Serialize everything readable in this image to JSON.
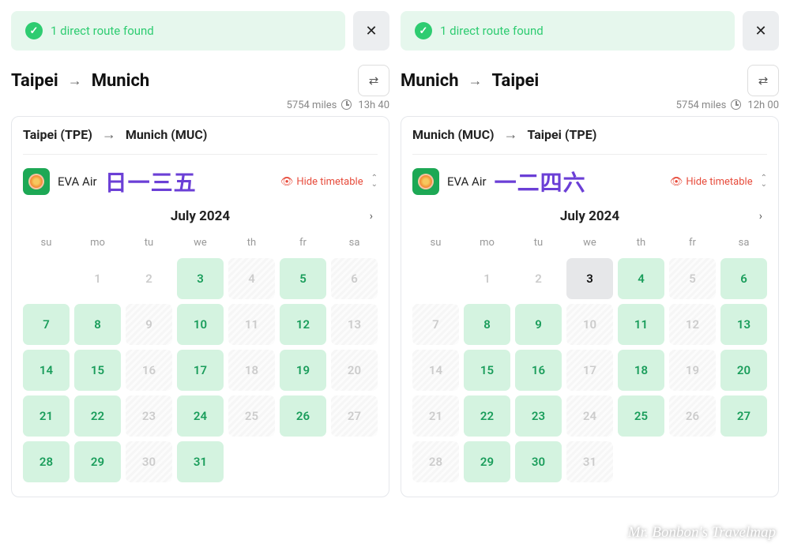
{
  "panels": [
    {
      "alert": "1 direct route found",
      "route": {
        "origin": "Taipei",
        "dest": "Munich"
      },
      "miles": "5754 miles",
      "duration": "13h 40",
      "airports": {
        "origin": "Taipei (TPE)",
        "dest": "Munich (MUC)"
      },
      "airline": "EVA Air",
      "annotation": "日一三五",
      "hide_label": "Hide timetable",
      "month": "July 2024",
      "weekdays": [
        "su",
        "mo",
        "tu",
        "we",
        "th",
        "fr",
        "sa"
      ],
      "days": [
        {
          "n": "",
          "s": "empty"
        },
        {
          "n": "1",
          "s": "disabled"
        },
        {
          "n": "2",
          "s": "disabled"
        },
        {
          "n": "3",
          "s": "available"
        },
        {
          "n": "4",
          "s": "unavailable"
        },
        {
          "n": "5",
          "s": "available"
        },
        {
          "n": "6",
          "s": "unavailable"
        },
        {
          "n": "7",
          "s": "available"
        },
        {
          "n": "8",
          "s": "available"
        },
        {
          "n": "9",
          "s": "unavailable"
        },
        {
          "n": "10",
          "s": "available"
        },
        {
          "n": "11",
          "s": "unavailable"
        },
        {
          "n": "12",
          "s": "available"
        },
        {
          "n": "13",
          "s": "unavailable"
        },
        {
          "n": "14",
          "s": "available"
        },
        {
          "n": "15",
          "s": "available"
        },
        {
          "n": "16",
          "s": "unavailable"
        },
        {
          "n": "17",
          "s": "available"
        },
        {
          "n": "18",
          "s": "unavailable"
        },
        {
          "n": "19",
          "s": "available"
        },
        {
          "n": "20",
          "s": "unavailable"
        },
        {
          "n": "21",
          "s": "available"
        },
        {
          "n": "22",
          "s": "available"
        },
        {
          "n": "23",
          "s": "unavailable"
        },
        {
          "n": "24",
          "s": "available"
        },
        {
          "n": "25",
          "s": "unavailable"
        },
        {
          "n": "26",
          "s": "available"
        },
        {
          "n": "27",
          "s": "unavailable"
        },
        {
          "n": "28",
          "s": "available"
        },
        {
          "n": "29",
          "s": "available"
        },
        {
          "n": "30",
          "s": "unavailable"
        },
        {
          "n": "31",
          "s": "available"
        }
      ]
    },
    {
      "alert": "1 direct route found",
      "route": {
        "origin": "Munich",
        "dest": "Taipei"
      },
      "miles": "5754 miles",
      "duration": "12h 00",
      "airports": {
        "origin": "Munich (MUC)",
        "dest": "Taipei (TPE)"
      },
      "airline": "EVA Air",
      "annotation": "一二四六",
      "hide_label": "Hide timetable",
      "month": "July 2024",
      "weekdays": [
        "su",
        "mo",
        "tu",
        "we",
        "th",
        "fr",
        "sa"
      ],
      "days": [
        {
          "n": "",
          "s": "empty"
        },
        {
          "n": "1",
          "s": "disabled"
        },
        {
          "n": "2",
          "s": "disabled"
        },
        {
          "n": "3",
          "s": "selected"
        },
        {
          "n": "4",
          "s": "available"
        },
        {
          "n": "5",
          "s": "unavailable"
        },
        {
          "n": "6",
          "s": "available"
        },
        {
          "n": "7",
          "s": "unavailable"
        },
        {
          "n": "8",
          "s": "available"
        },
        {
          "n": "9",
          "s": "available"
        },
        {
          "n": "10",
          "s": "unavailable"
        },
        {
          "n": "11",
          "s": "available"
        },
        {
          "n": "12",
          "s": "unavailable"
        },
        {
          "n": "13",
          "s": "available"
        },
        {
          "n": "14",
          "s": "unavailable"
        },
        {
          "n": "15",
          "s": "available"
        },
        {
          "n": "16",
          "s": "available"
        },
        {
          "n": "17",
          "s": "unavailable"
        },
        {
          "n": "18",
          "s": "available"
        },
        {
          "n": "19",
          "s": "unavailable"
        },
        {
          "n": "20",
          "s": "available"
        },
        {
          "n": "21",
          "s": "unavailable"
        },
        {
          "n": "22",
          "s": "available"
        },
        {
          "n": "23",
          "s": "available"
        },
        {
          "n": "24",
          "s": "unavailable"
        },
        {
          "n": "25",
          "s": "available"
        },
        {
          "n": "26",
          "s": "unavailable"
        },
        {
          "n": "27",
          "s": "available"
        },
        {
          "n": "28",
          "s": "unavailable"
        },
        {
          "n": "29",
          "s": "available"
        },
        {
          "n": "30",
          "s": "available"
        },
        {
          "n": "31",
          "s": "unavailable"
        }
      ]
    }
  ],
  "watermark": "Mr. Bonbon's Travelmap"
}
